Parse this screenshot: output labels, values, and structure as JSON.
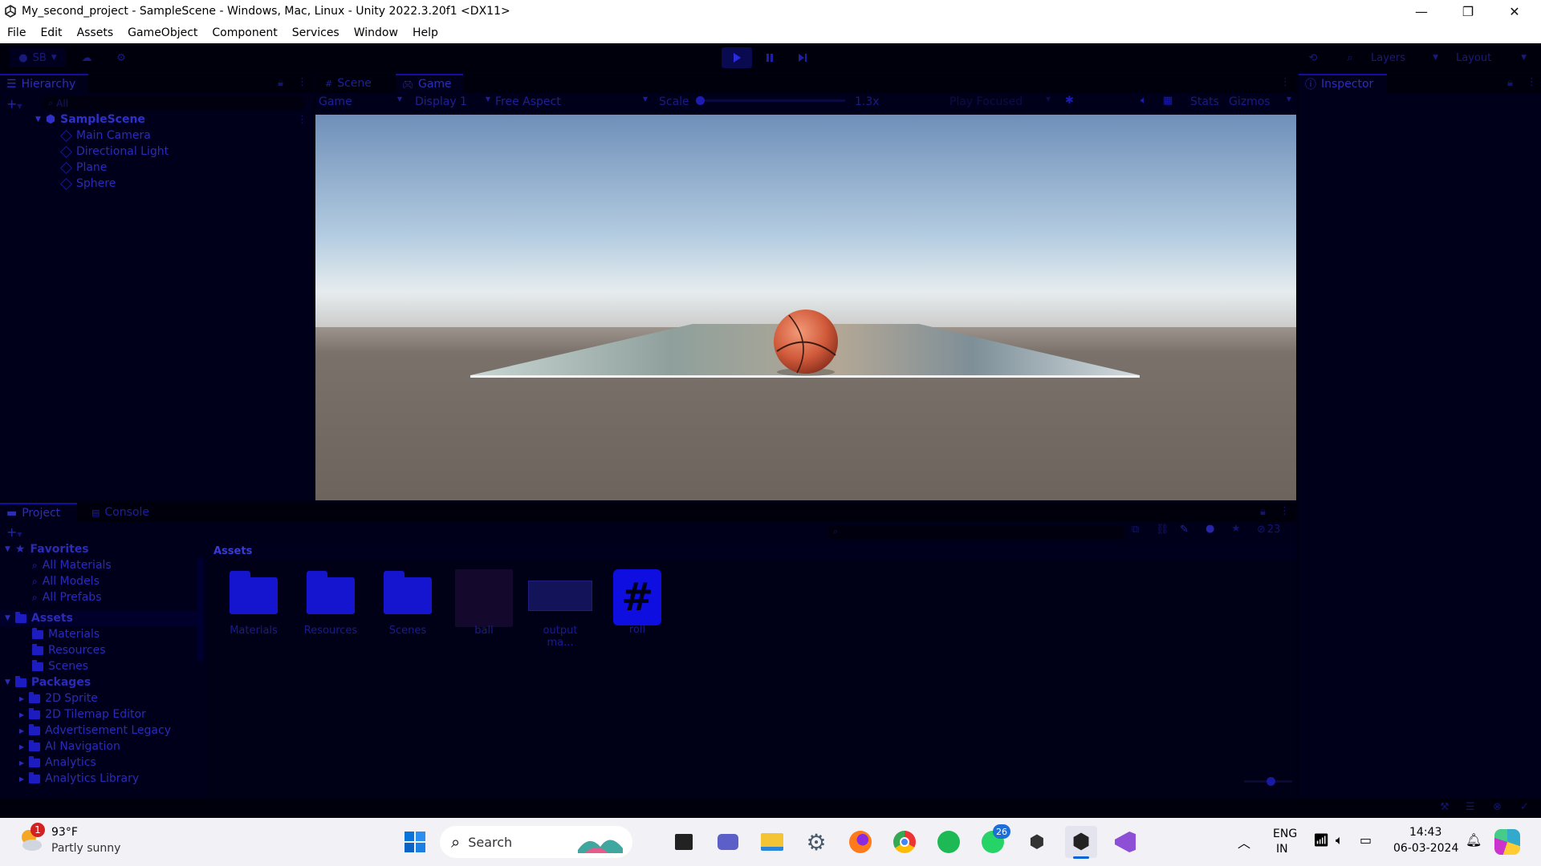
{
  "window": {
    "title": "My_second_project - SampleScene - Windows, Mac, Linux - Unity 2022.3.20f1 <DX11>",
    "minimize": "—",
    "maximize": "❐",
    "close": "✕"
  },
  "menu": [
    "File",
    "Edit",
    "Assets",
    "GameObject",
    "Component",
    "Services",
    "Window",
    "Help"
  ],
  "toolbar": {
    "account": "SB",
    "layers": "Layers",
    "layout": "Layout"
  },
  "hierarchy": {
    "tab": "Hierarchy",
    "search_placeholder": "All",
    "scene": "SampleScene",
    "items": [
      "Main Camera",
      "Directional Light",
      "Plane",
      "Sphere"
    ]
  },
  "view_tabs": {
    "scene": "Scene",
    "game": "Game"
  },
  "game_toolbar": {
    "mode": "Game",
    "display": "Display 1",
    "aspect": "Free Aspect",
    "scale_label": "Scale",
    "scale_value": "1.3x",
    "play_focused": "Play Focused",
    "stats": "Stats",
    "gizmos": "Gizmos"
  },
  "inspector": {
    "tab": "Inspector"
  },
  "project": {
    "tab_project": "Project",
    "tab_console": "Console",
    "hidden_count": "23",
    "breadcrumb": "Assets",
    "favorites": {
      "label": "Favorites",
      "items": [
        "All Materials",
        "All Models",
        "All Prefabs"
      ]
    },
    "assets_tree": {
      "label": "Assets",
      "items": [
        "Materials",
        "Resources",
        "Scenes"
      ]
    },
    "packages": {
      "label": "Packages",
      "items": [
        "2D Sprite",
        "2D Tilemap Editor",
        "Advertisement Legacy",
        "AI Navigation",
        "Analytics",
        "Analytics Library"
      ]
    },
    "grid": [
      {
        "name": "Materials",
        "kind": "folder"
      },
      {
        "name": "Resources",
        "kind": "folder"
      },
      {
        "name": "Scenes",
        "kind": "folder"
      },
      {
        "name": "ball",
        "kind": "texture"
      },
      {
        "name": "output ma...",
        "kind": "texture"
      },
      {
        "name": "roll",
        "kind": "script"
      }
    ]
  },
  "taskbar": {
    "weather_temp": "93°F",
    "weather_desc": "Partly sunny",
    "weather_badge": "1",
    "search": "Search",
    "whatsapp_badge": "26",
    "lang_top": "ENG",
    "lang_bottom": "IN",
    "time": "14:43",
    "date": "06-03-2024"
  }
}
